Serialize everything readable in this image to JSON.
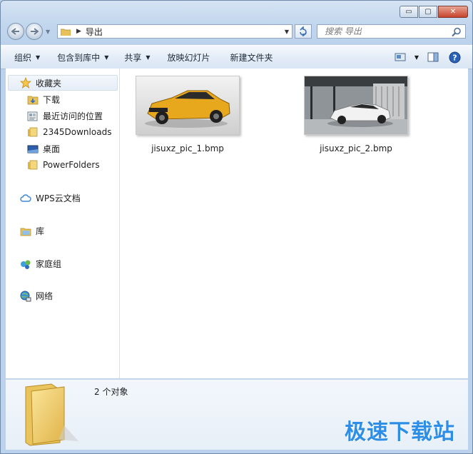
{
  "window": {
    "caption_buttons": [
      "▭",
      "▢",
      "✕"
    ]
  },
  "address_bar": {
    "path": "导出"
  },
  "search": {
    "placeholder": "搜索 导出"
  },
  "toolbar": {
    "organize": "组织",
    "include_in_library": "包含到库中",
    "share": "共享",
    "slideshow": "放映幻灯片",
    "new_folder": "新建文件夹"
  },
  "sidebar": {
    "favorites": "收藏夹",
    "fav_items": [
      {
        "label": "下载",
        "icon": "download-folder-icon"
      },
      {
        "label": "最近访问的位置",
        "icon": "recent-places-icon"
      },
      {
        "label": "2345Downloads",
        "icon": "folder-icon"
      },
      {
        "label": "桌面",
        "icon": "desktop-icon"
      },
      {
        "label": "PowerFolders",
        "icon": "folder-icon"
      }
    ],
    "groups": [
      {
        "label": "WPS云文档",
        "icon": "cloud-icon"
      },
      {
        "label": "库",
        "icon": "library-icon"
      },
      {
        "label": "家庭组",
        "icon": "homegroup-icon"
      },
      {
        "label": "网络",
        "icon": "network-icon"
      }
    ]
  },
  "files": [
    {
      "name": "jisuxz_pic_1.bmp",
      "color": "#e7a81e"
    },
    {
      "name": "jisuxz_pic_2.bmp",
      "color": "#f2f2f2"
    }
  ],
  "details": {
    "count": "2 个对象"
  },
  "watermark": "极速下载站",
  "colors": {
    "accent": "#2c8ee6",
    "toolbar_text": "#1c2b3a"
  }
}
